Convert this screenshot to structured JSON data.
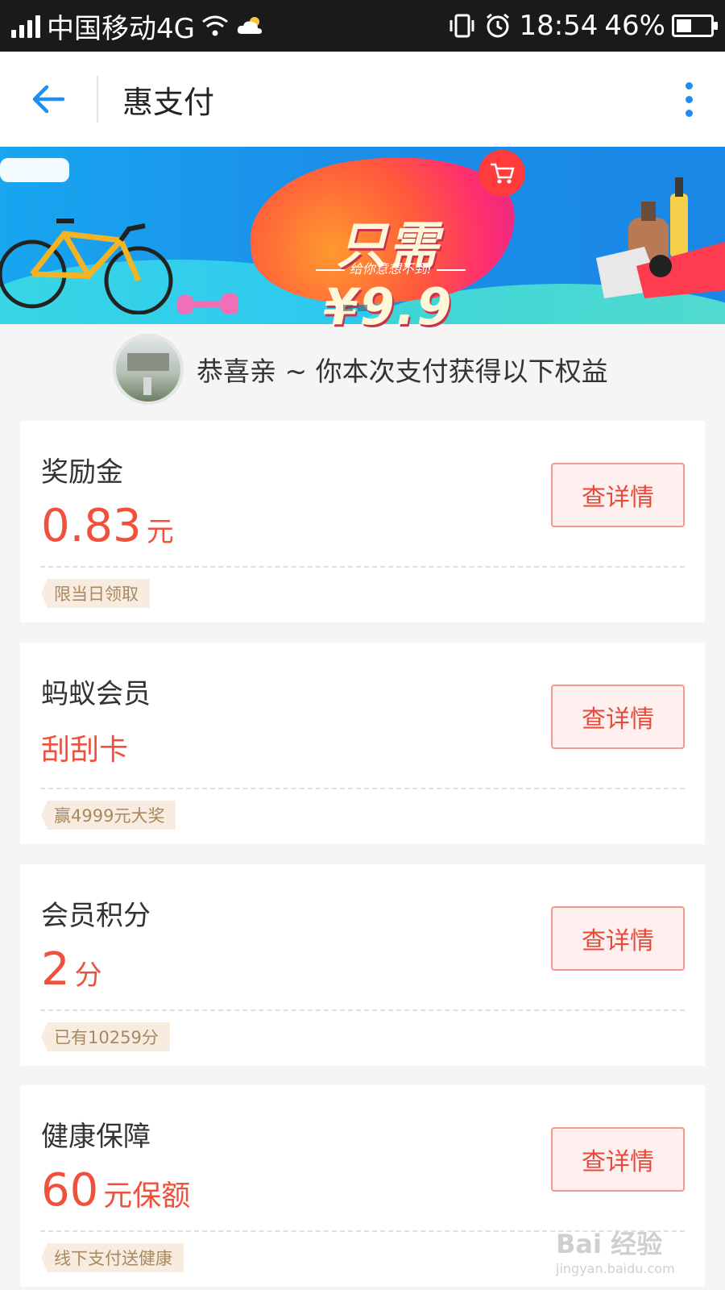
{
  "status_bar": {
    "carrier": "中国移动4G",
    "time": "18:54",
    "battery": "46%",
    "battery_level": 0.46
  },
  "header": {
    "title": "惠支付"
  },
  "banner": {
    "headline": "只需¥9.9",
    "subtext": "给你意想不到!"
  },
  "greeting": {
    "text": "恭喜亲 ~ 你本次支付获得以下权益"
  },
  "cards": [
    {
      "title": "奖励金",
      "value": "0.83",
      "unit": "元",
      "button": "查详情",
      "tag": "限当日领取"
    },
    {
      "title": "蚂蚁会员",
      "value": "刮刮卡",
      "button": "查详情",
      "tag": "赢4999元大奖"
    },
    {
      "title": "会员积分",
      "value": "2",
      "unit": "分",
      "button": "查详情",
      "tag": "已有10259分"
    },
    {
      "title": "健康保障",
      "value": "60",
      "unit": "元保额",
      "button": "查详情",
      "tag": "线下支付送健康"
    }
  ],
  "watermark": {
    "brand": "Bai 经验",
    "url": "jingyan.baidu.com"
  },
  "colors": {
    "accent_red": "#f0503c",
    "nav_blue": "#1f8ef1",
    "tag_bg": "#f7ecdf",
    "tag_text": "#a8895f"
  }
}
